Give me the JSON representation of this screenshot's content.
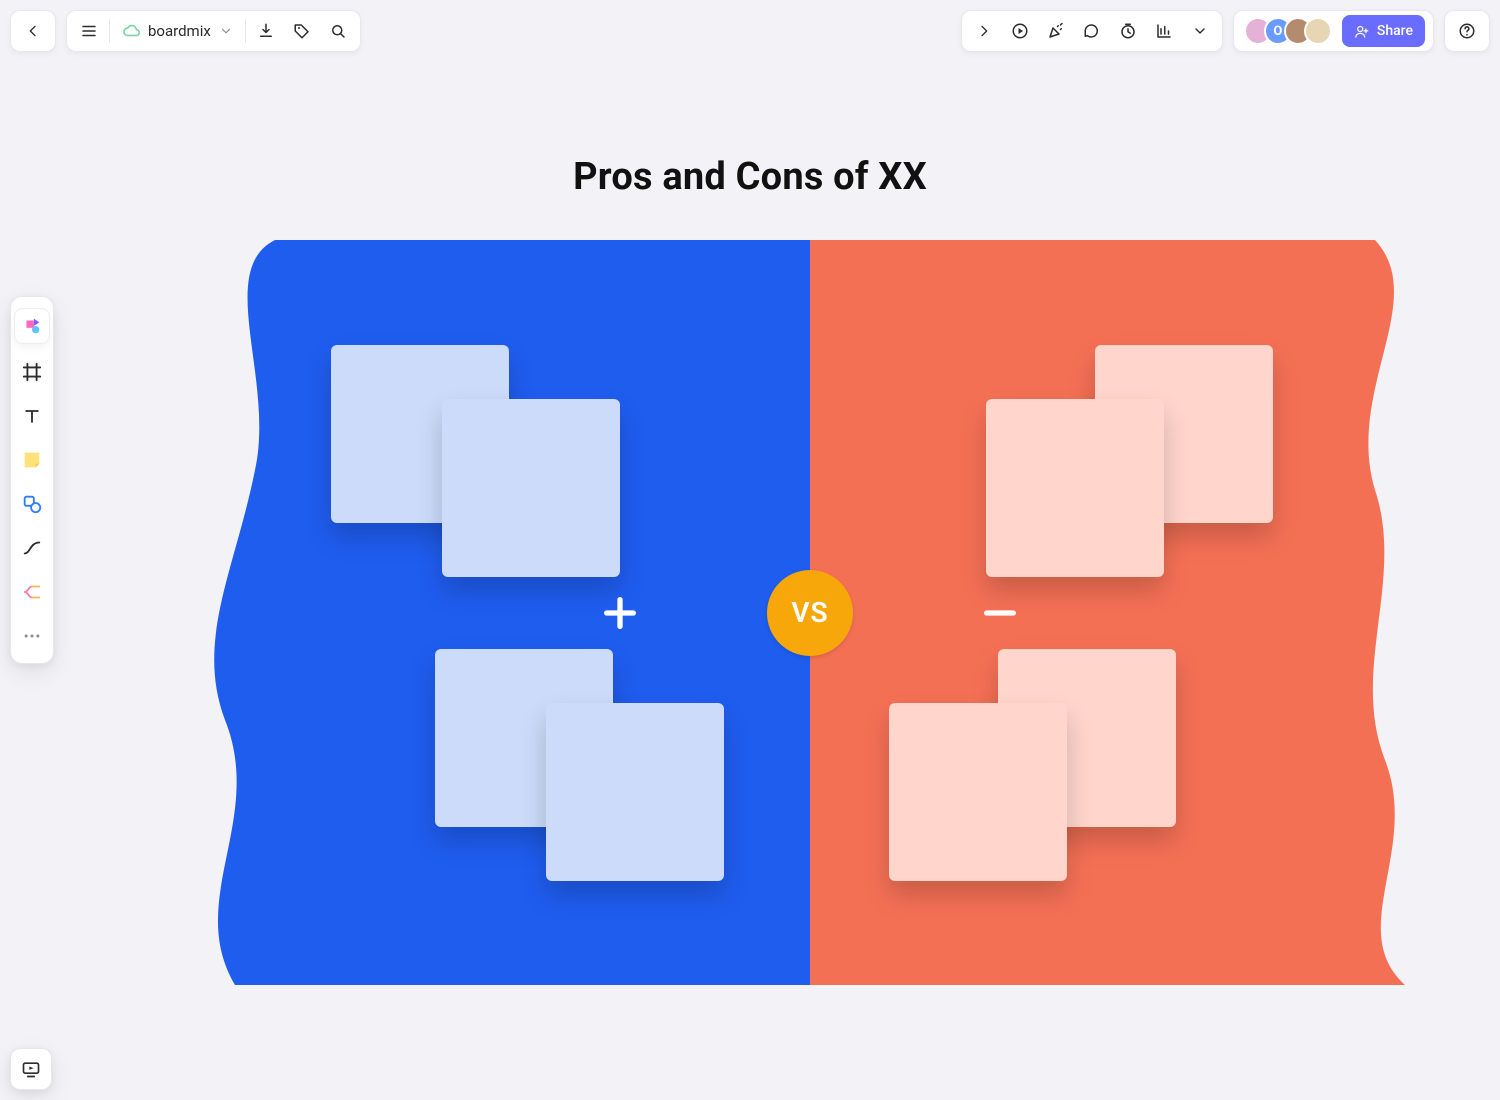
{
  "app": {
    "doc_title": "boardmix",
    "share_label": "Share"
  },
  "canvas": {
    "title": "Pros and Cons of XX",
    "vs_label": "VS",
    "colors": {
      "blue": "#1f5def",
      "red": "#f47055",
      "badge": "#f7a709",
      "sticky_blue": "#cbdbf9",
      "sticky_red": "#ffd5cc"
    }
  },
  "avatars": [
    {
      "bg": "#e6b1d6"
    },
    {
      "bg": "#6a9cff",
      "letter": "O"
    },
    {
      "bg": "#b58b6e"
    },
    {
      "bg": "#e7d6b3"
    }
  ],
  "icons": {
    "top_left": [
      "back-icon",
      "menu-icon",
      "doc-title",
      "download-icon",
      "tag-icon",
      "search-icon"
    ],
    "top_right": [
      "expand-right-icon",
      "play-icon",
      "party-icon",
      "comment-icon",
      "timer-icon",
      "chart-icon",
      "chevron-down-icon"
    ],
    "left_tools": [
      "shapes-multicolor-icon",
      "frame-icon",
      "text-icon",
      "sticky-note-icon",
      "shape-icon",
      "connector-icon",
      "mindmap-icon",
      "more-icon"
    ]
  }
}
